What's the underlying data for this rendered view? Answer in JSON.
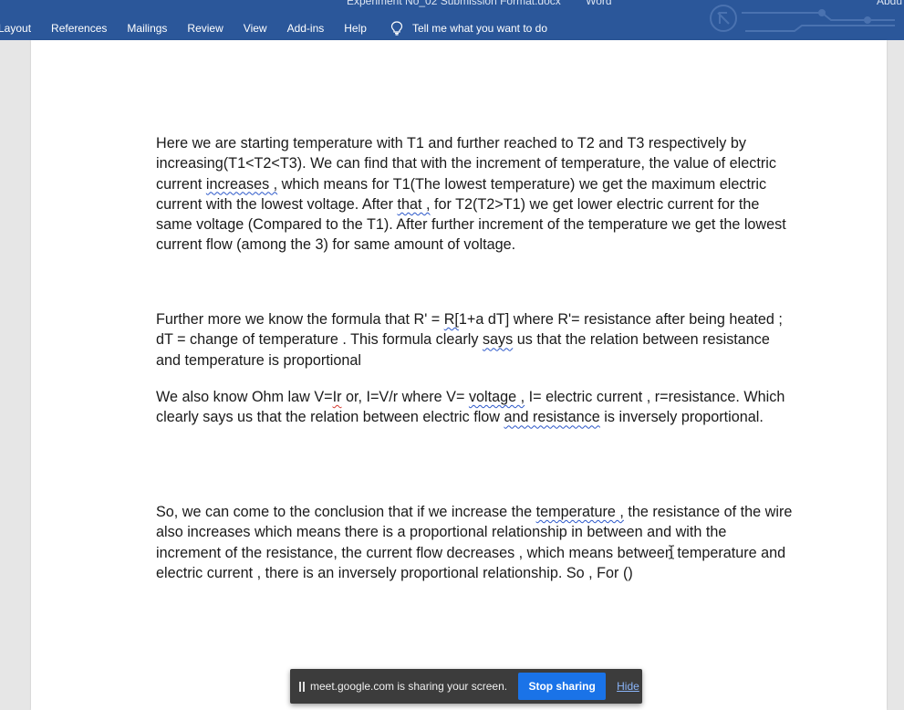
{
  "ribbon": {
    "title_left": "Experiment No_02 Submission Format.docx",
    "title_right": "Word",
    "user": "Abdu",
    "tabs": [
      "Layout",
      "References",
      "Mailings",
      "Review",
      "View",
      "Add-ins",
      "Help"
    ],
    "tell_me": "Tell me what you want to do",
    "accent": "#2b579a"
  },
  "document": {
    "p1": {
      "a": "Here we are starting temperature with T1 and further reached to T2 and T3 respectively by increasing(T1<T2<T3). We can find that with the increment of temperature, the value of electric current ",
      "sq1": "increases ,",
      "b": " which means for T1(The lowest temperature) we get the maximum electric current with the lowest voltage. After ",
      "sq2": "that ,",
      "c": " for T2(T2>T1) we get lower electric current for the same voltage (Compared to the T1).  After further increment of the temperature we get the lowest current flow (among the 3) for same amount of voltage."
    },
    "p2": {
      "a": "Further more we know the formula that R' = ",
      "sq1": "R[",
      "b": "1+a dT] where R'= resistance after being heated ; dT = change of temperature . This formula clearly ",
      "sq2": "says",
      "c": " us that the relation between resistance and temperature is proportional"
    },
    "p3": {
      "a": "We also know Ohm law V=",
      "sq1": "Ir",
      "b": " or, I=V/r where V= ",
      "sq2": "voltage ,",
      "c": " I= electric current , r=resistance. Which clearly says us that the relation between electric flow ",
      "sq3": "and  resistance",
      "d": " is inversely proportional."
    },
    "p4": {
      "a": "So, we can come to the conclusion that if we increase the ",
      "sq1": "temperature ,",
      "b": " the resistance of the wire also increases which means there is a proportional relationship in between and with the increment of the resistance, the current flow decreases , which means between temperature and electric current , there is an inversely proportional relationship. So , For ()"
    }
  },
  "share_bar": {
    "message": "meet.google.com is sharing your screen.",
    "stop_label": "Stop sharing",
    "hide_label": "Hide",
    "button_color": "#1a73e8"
  }
}
